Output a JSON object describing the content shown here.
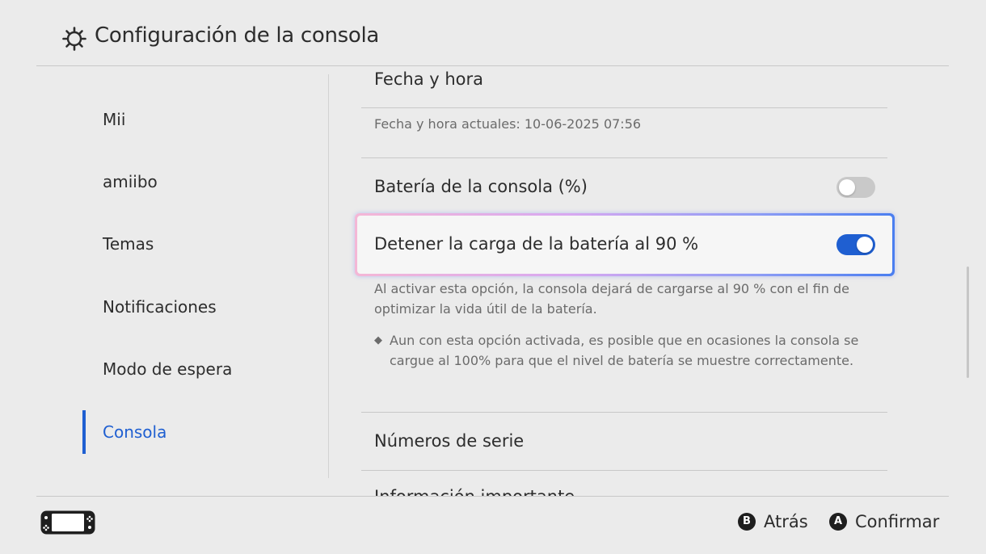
{
  "header": {
    "title": "Configuración de la consola",
    "icon": "gear-icon"
  },
  "sidebar": {
    "items": [
      {
        "label": "Mii"
      },
      {
        "label": "amiibo"
      },
      {
        "label": "Temas"
      },
      {
        "label": "Notificaciones"
      },
      {
        "label": "Modo de espera"
      },
      {
        "label": "Consola",
        "active": true
      }
    ]
  },
  "content": {
    "date_time": {
      "label": "Fecha y hora",
      "current": "Fecha y hora actuales: 10-06-2025 07:56"
    },
    "battery_percent": {
      "label": "Batería de la consola (%)",
      "enabled": false
    },
    "stop_charge": {
      "label": "Detener la carga de la batería al 90 %",
      "enabled": true,
      "description": "Al activar esta opción, la consola dejará de cargarse al 90 % con el fin de optimizar la vida útil de la batería.",
      "note": "Aun con esta opción activada, es posible que en ocasiones la consola se cargue al 100% para que el nivel de batería se muestre correctamente."
    },
    "serial_numbers": {
      "label": "Números de serie"
    },
    "important_info": {
      "label": "Información importante"
    }
  },
  "footer": {
    "back": {
      "button": "B",
      "label": "Atrás"
    },
    "confirm": {
      "button": "A",
      "label": "Confirmar"
    }
  },
  "colors": {
    "accent": "#1f5fd1",
    "background": "#ebebeb",
    "text": "#2d2d2d",
    "muted": "#6b6b6b"
  }
}
